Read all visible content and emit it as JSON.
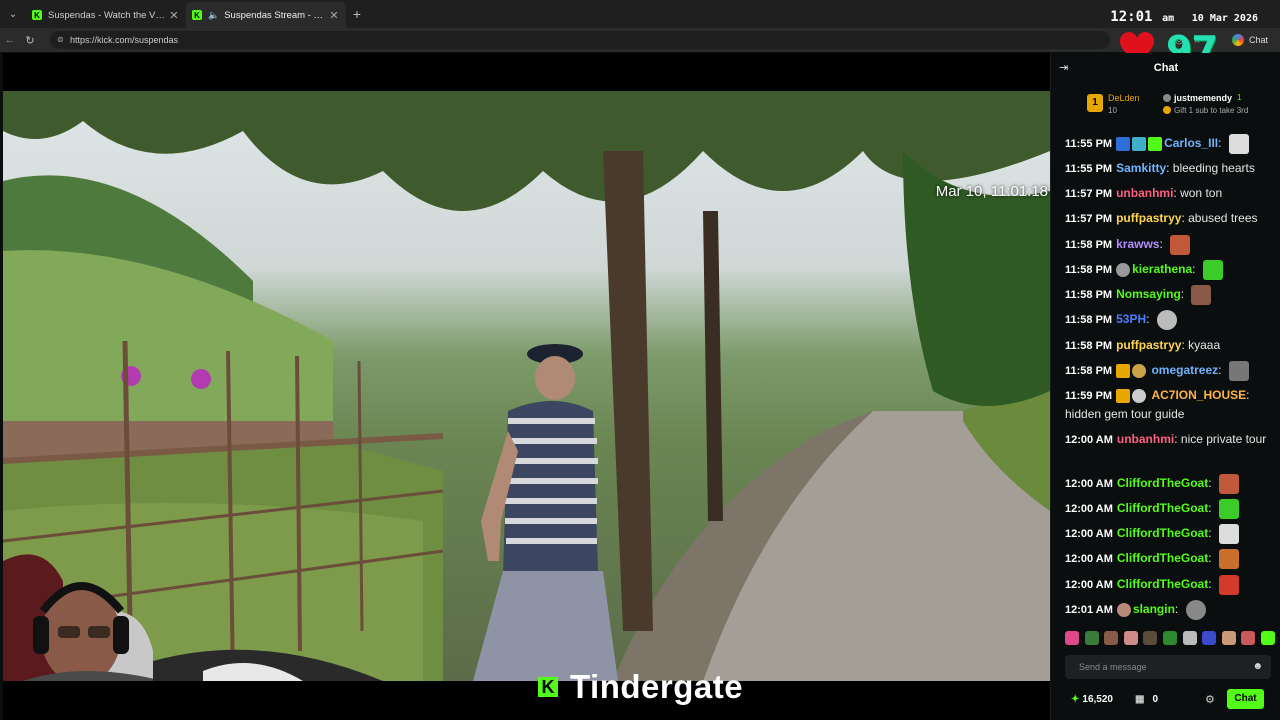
{
  "browser": {
    "tabs": [
      {
        "title": "Suspendas - Watch the VOD on K",
        "active": false
      },
      {
        "title": "Suspendas Stream - Watch Li",
        "active": true
      }
    ],
    "url": "https://kick.com/suspendas",
    "chat_label": "Chat"
  },
  "overlay_clock": {
    "time": "12:01",
    "ampm": "am",
    "date": "10 Mar 2026"
  },
  "counter": "97",
  "video": {
    "date_overlay": "Mar 10, 11:01:18",
    "streamer": "Tindergate",
    "brand_letter": "K"
  },
  "chat": {
    "title": "Chat",
    "top_gifters": [
      {
        "rank": "1",
        "name": "DeLden",
        "count": "10"
      },
      {
        "name": "justmemendy",
        "count": "1",
        "note": "Gift 1 sub to take 3rd"
      }
    ],
    "messages": [
      {
        "time": "11:55 PM",
        "user": "Carlos_III",
        "text": "",
        "color": "#6fb3ff"
      },
      {
        "time": "11:55 PM",
        "user": "Samkitty",
        "text": "bleeding hearts",
        "color": "#6fb3ff"
      },
      {
        "time": "11:57 PM",
        "user": "unbanhmi",
        "text": "won ton",
        "color": "#ff5f7e"
      },
      {
        "time": "11:57 PM",
        "user": "puffpastryy",
        "text": "abused trees",
        "color": "#ffd54f"
      },
      {
        "time": "11:58 PM",
        "user": "krawws",
        "text": "",
        "color": "#b38cff"
      },
      {
        "time": "11:58 PM",
        "user": "kierathena",
        "text": "",
        "color": "#53fc18"
      },
      {
        "time": "11:58 PM",
        "user": "Nomsaying",
        "text": "",
        "color": "#53fc18"
      },
      {
        "time": "11:58 PM",
        "user": "53PH",
        "text": "",
        "color": "#4a7dff"
      },
      {
        "time": "11:58 PM",
        "user": "puffpastryy",
        "text": "kyaaa",
        "color": "#ffd54f"
      },
      {
        "time": "11:58 PM",
        "user": "omegatreez",
        "text": "",
        "color": "#6fb3ff"
      },
      {
        "time": "11:59 PM",
        "user": "AC7ION_HOUSE",
        "text": "hidden gem tour guide",
        "color": "#ffb347"
      },
      {
        "time": "12:00 AM",
        "user": "unbanhmi",
        "text": "nice private tour",
        "color": "#ff5f7e"
      },
      {
        "time": "12:00 AM",
        "user": "CliffordTheGoat",
        "text": "",
        "color": "#53fc18"
      },
      {
        "time": "12:00 AM",
        "user": "CliffordTheGoat",
        "text": "",
        "color": "#53fc18"
      },
      {
        "time": "12:00 AM",
        "user": "CliffordTheGoat",
        "text": "",
        "color": "#53fc18"
      },
      {
        "time": "12:00 AM",
        "user": "CliffordTheGoat",
        "text": "",
        "color": "#53fc18"
      },
      {
        "time": "12:00 AM",
        "user": "CliffordTheGoat",
        "text": "",
        "color": "#53fc18"
      },
      {
        "time": "12:01 AM",
        "user": "slangin",
        "text": "",
        "color": "#53fc18"
      }
    ],
    "input_placeholder": "Send a message",
    "points": "16,520",
    "kicks": "0",
    "chat_button": "Chat"
  },
  "colors": {
    "kick_green": "#53fc18",
    "panel_bg": "#0b0e0f",
    "gift_gold": "#e5a700"
  }
}
